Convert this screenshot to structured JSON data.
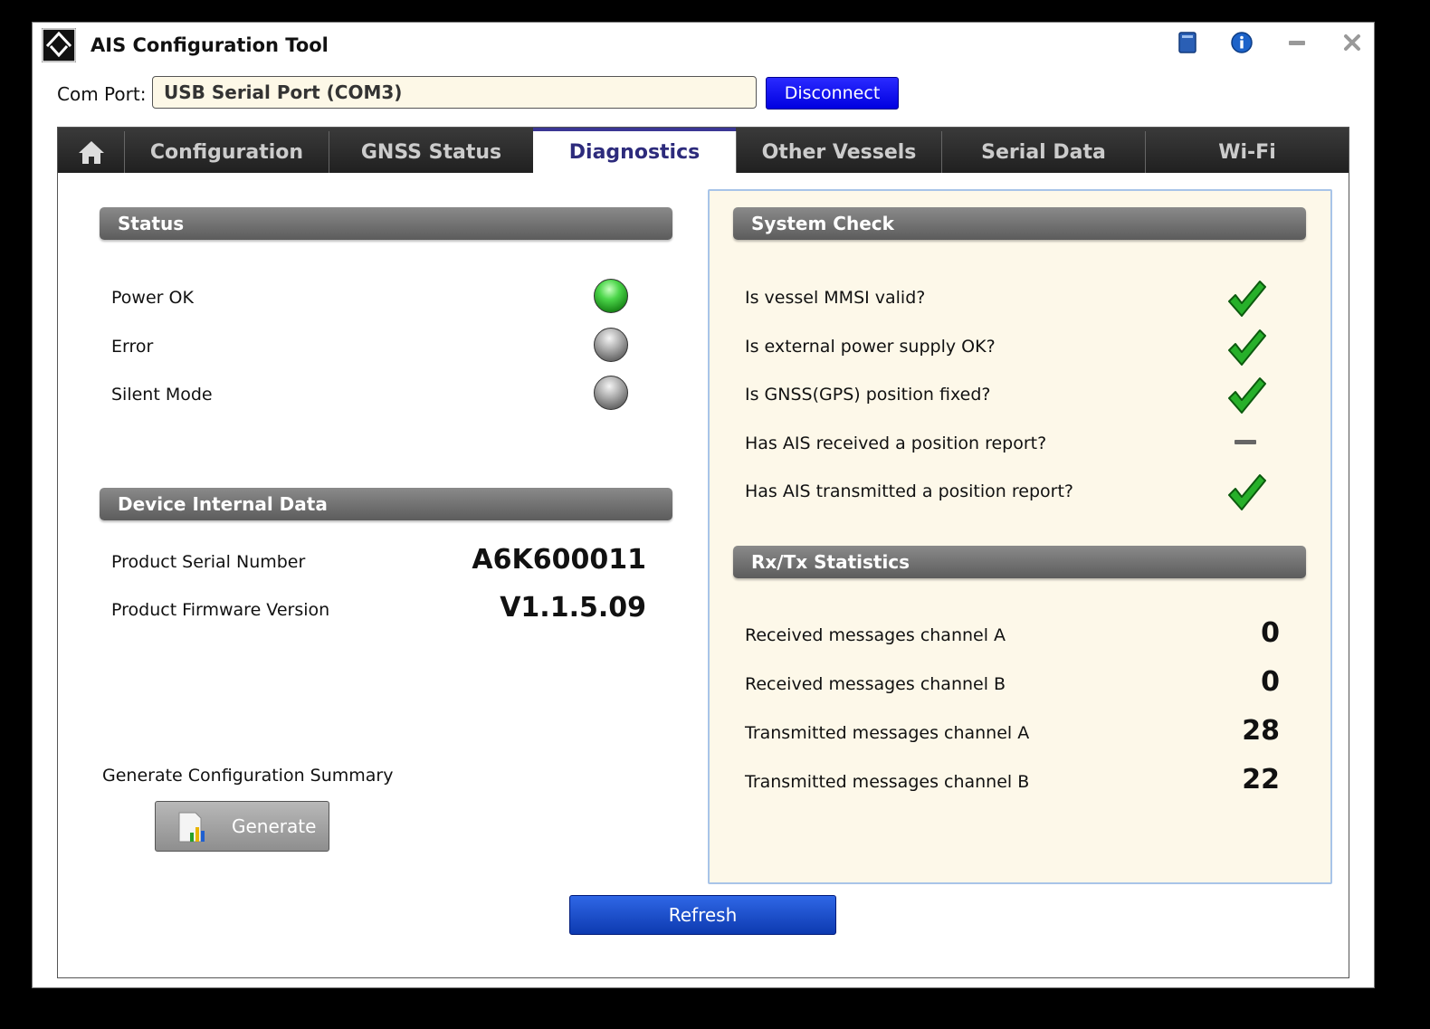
{
  "window": {
    "title": "AIS Configuration Tool"
  },
  "icons": {
    "logo": "app-logo-icon",
    "book": "book-icon",
    "info": "info-icon",
    "minimize": "minimize-icon",
    "close": "close-icon",
    "home": "home-icon",
    "check": "checkmark-icon",
    "report": "report-chart-icon"
  },
  "comport": {
    "label": "Com Port:",
    "value": "USB Serial Port (COM3)",
    "button": "Disconnect"
  },
  "tabs": [
    "Configuration",
    "GNSS Status",
    "Diagnostics",
    "Other Vessels",
    "Serial Data",
    "Wi-Fi"
  ],
  "active_tab": "Diagnostics",
  "status": {
    "title": "Status",
    "items": [
      {
        "label": "Power OK",
        "state": "on"
      },
      {
        "label": "Error",
        "state": "off"
      },
      {
        "label": "Silent Mode",
        "state": "off"
      }
    ]
  },
  "device": {
    "title": "Device Internal Data",
    "serial_label": "Product Serial Number",
    "serial_value": "A6K600011",
    "firmware_label": "Product Firmware Version",
    "firmware_value": "V1.1.5.09"
  },
  "summary": {
    "label": "Generate Configuration Summary",
    "button": "Generate"
  },
  "system_check": {
    "title": "System Check",
    "items": [
      {
        "label": "Is vessel MMSI valid?",
        "result": "pass"
      },
      {
        "label": "Is external power supply OK?",
        "result": "pass"
      },
      {
        "label": "Is GNSS(GPS) position fixed?",
        "result": "pass"
      },
      {
        "label": "Has AIS received a position report?",
        "result": "none"
      },
      {
        "label": "Has AIS transmitted a position report?",
        "result": "pass"
      }
    ]
  },
  "stats": {
    "title": "Rx/Tx Statistics",
    "items": [
      {
        "label": "Received messages channel A",
        "value": "0"
      },
      {
        "label": "Received messages channel B",
        "value": "0"
      },
      {
        "label": "Transmitted messages channel A",
        "value": "28"
      },
      {
        "label": "Transmitted messages channel B",
        "value": "22"
      }
    ]
  },
  "refresh": {
    "button": "Refresh"
  },
  "colors": {
    "accent_blue": "#0000e0",
    "active_tab_text": "#2d2b7c",
    "panel_bg": "#fdf8e9",
    "panel_border": "#a8c4e8",
    "led_on": "#4cd64a"
  }
}
